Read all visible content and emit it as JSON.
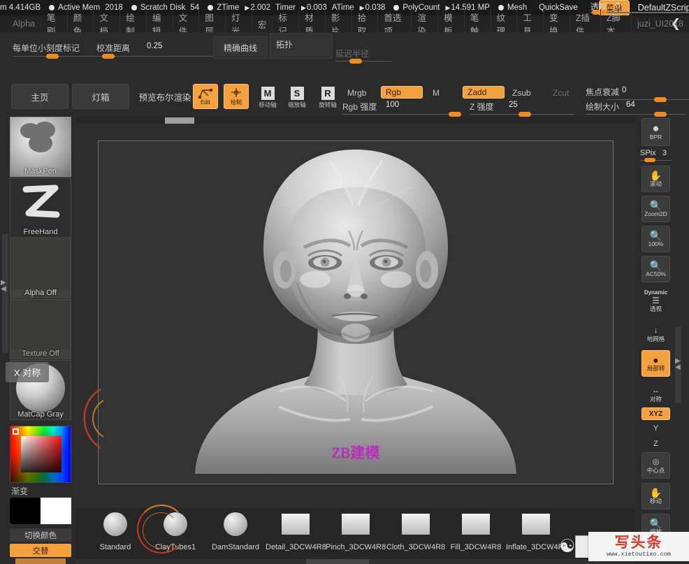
{
  "titlebar": {
    "mem": "m 4.414GB",
    "active_mem_label": "Active Mem",
    "active_mem_value": "2018",
    "scratch_label": "Scratch Disk",
    "scratch_value": "54",
    "ztime_label": "ZTime",
    "ztime_value": "2.002",
    "timer_label": "Timer",
    "timer_value": "0.003",
    "atime_label": "ATime",
    "atime_value": "0.038",
    "polycount_label": "PolyCount",
    "polycount_value": "14.591 MP",
    "mesh_label": "Mesh",
    "quicksave": "QuickSave",
    "perspective_label": "透视",
    "perspective_value": "0",
    "menu_button": "菜单",
    "zscript_name": "DefaultZScript",
    "sound_icon": "volume-icon"
  },
  "menubar": {
    "items": [
      {
        "label": "Alpha",
        "dim": true
      },
      {
        "label": "笔刷",
        "dim": false
      },
      {
        "label": "颜色",
        "dim": false
      },
      {
        "label": "文档",
        "dim": false
      },
      {
        "label": "绘制",
        "dim": false
      },
      {
        "label": "编辑",
        "dim": false
      },
      {
        "label": "文件",
        "dim": false
      },
      {
        "label": "图层",
        "dim": false
      },
      {
        "label": "灯光",
        "dim": false
      },
      {
        "label": "宏",
        "dim": false
      },
      {
        "label": "标记",
        "dim": false
      },
      {
        "label": "材质",
        "dim": false
      },
      {
        "label": "影片",
        "dim": false
      },
      {
        "label": "拾取",
        "dim": false
      },
      {
        "label": "首选项",
        "dim": false
      },
      {
        "label": "渲染",
        "dim": false
      },
      {
        "label": "模板",
        "dim": false
      },
      {
        "label": "笔触",
        "dim": false
      },
      {
        "label": "纹理",
        "dim": false
      },
      {
        "label": "工具",
        "dim": false
      },
      {
        "label": "变换",
        "dim": false
      },
      {
        "label": "Z插件",
        "dim": false
      },
      {
        "label": "Z脚本",
        "dim": false
      },
      {
        "label": "juzi_UI2018",
        "dim": true
      }
    ],
    "cursor_icon": "arrow-cursor-icon"
  },
  "shelf_top": {
    "tick_label": "每单位小刻度标记",
    "calibration_label": "校准距离",
    "calibration_value": "0.25",
    "accurate_curve": "精确曲线",
    "topology": "拓扑",
    "delay_radius": "延迟半径",
    "symmetry_x": "X 对称"
  },
  "shelf_modes": {
    "home": "主页",
    "lightbox": "灯箱",
    "preview_bool": "预览布尔渲染",
    "edit": "Edit",
    "draw": "绘制",
    "move_axis": "移动轴",
    "scale_axis": "缩放轴",
    "rotate_axis": "旋转轴",
    "mrgb": "Mrgb",
    "rgb": "Rgb",
    "m": "M",
    "zadd": "Zadd",
    "zsub": "Zsub",
    "zcut": "Zcut",
    "focal_label": "焦点衰减",
    "focal_value": "0",
    "rgb_intensity_label": "Rgb 强度",
    "rgb_intensity_value": "100",
    "z_intensity_label": "Z 强度",
    "z_intensity_value": "25",
    "draw_size_label": "绘制大小",
    "draw_size_value": "64"
  },
  "left_palette": {
    "items": [
      {
        "label": "MaskPen",
        "kind": "alpha-brush",
        "selected": true
      },
      {
        "label": "FreeHand",
        "kind": "stroke",
        "selected": false
      },
      {
        "label": "Alpha Off",
        "kind": "alpha",
        "selected": false
      },
      {
        "label": "Texture Off",
        "kind": "texture",
        "selected": false
      },
      {
        "label": "MatCap Gray",
        "kind": "material",
        "selected": false
      }
    ],
    "tooltip": "X 对称",
    "gradient_label": "渐变",
    "switch_color": "切换颜色",
    "alternate": "交替"
  },
  "canvas": {
    "annotation": "ZB建模",
    "model_name": "head-bust-sculpt"
  },
  "right_tools": {
    "bpr": "BPR",
    "spix_label": "SPix",
    "spix_value": "3",
    "items": [
      {
        "label": "滚动",
        "icon": "hand-scroll-icon",
        "on": false
      },
      {
        "label": "Zoom2D",
        "icon": "zoom-2d-icon",
        "on": false
      },
      {
        "label": "100%",
        "icon": "zoom-100-icon",
        "on": false
      },
      {
        "label": "AC50%",
        "icon": "zoom-actual-50-icon",
        "on": false
      },
      {
        "label": "透视",
        "icon": "dynamic-perspective-icon",
        "top": "Dynamic",
        "on": false
      },
      {
        "label": "地网格",
        "icon": "floor-grid-icon",
        "on": false
      },
      {
        "label": "局部转",
        "icon": "local-transform-icon",
        "on": true
      },
      {
        "label": "对称",
        "icon": "symmetry-icon",
        "on": false
      },
      {
        "label": "中心点",
        "icon": "center-point-icon",
        "on": false
      },
      {
        "label": "移动",
        "icon": "move-icon",
        "on": false
      },
      {
        "label": "缩放",
        "icon": "scale-icon",
        "on": false
      }
    ],
    "xyz": "XYZ",
    "y_axis": "Y",
    "z_axis": "Z"
  },
  "bottom_shelf": {
    "brushes": [
      {
        "label": "Standard",
        "icon": "sphere-brush-icon"
      },
      {
        "label": "ClayTubes1",
        "icon": "sphere-brush-icon"
      },
      {
        "label": "DamStandard",
        "icon": "sphere-brush-icon"
      },
      {
        "label": "Detail_3DCW4R8",
        "icon": "book-brush-icon"
      },
      {
        "label": "Pinch_3DCW4R8",
        "icon": "book-brush-icon"
      },
      {
        "label": "Cloth_3DCW4R8",
        "icon": "book-brush-icon"
      },
      {
        "label": "Fill_3DCW4R8",
        "icon": "book-brush-icon"
      },
      {
        "label": "Inflate_3DCW4R8",
        "icon": "book-brush-icon"
      }
    ]
  },
  "watermark": {
    "main": "写头条",
    "sub": "www.xietoutiao.com"
  },
  "colors": {
    "accent": "#f2a13c",
    "panel": "#2b2b2b",
    "canvas": "#333333",
    "annotation": "#d11fd6",
    "watermark_red": "#d33a2a"
  }
}
